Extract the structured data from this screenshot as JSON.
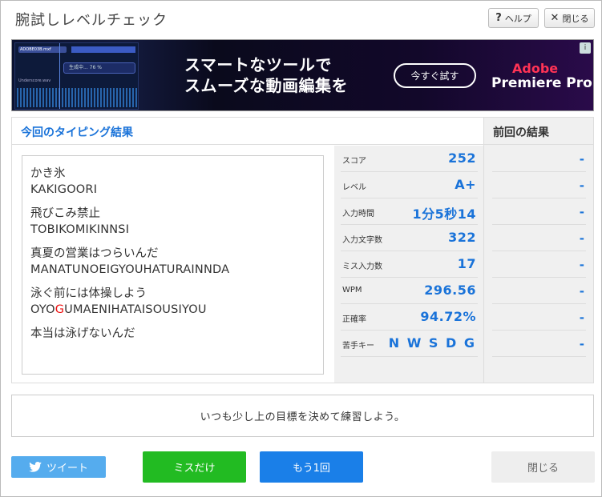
{
  "window": {
    "title": "腕試しレベルチェック",
    "help_label": "ヘルプ",
    "close_label": "閉じる"
  },
  "ad": {
    "headline_line1": "スマートなツールで",
    "headline_line2": "スムーズな動画編集を",
    "cta_label": "今すぐ試す",
    "brand_line1": "Adobe",
    "brand_line2": "Premiere Pro",
    "thumb_file": "ADOBE03B.mxf",
    "thumb_progress": "生成中...",
    "thumb_progress_pct": "76 %",
    "thumb_track": "Underscore.wav"
  },
  "result": {
    "header": "今回のタイピング結果",
    "prev_header": "前回の結果",
    "words": [
      {
        "jp": "かき氷",
        "romaji": "KAKIGOORI"
      },
      {
        "jp": "飛びこみ禁止",
        "romaji": "TOBIKOMIKINNSI"
      },
      {
        "jp": "真夏の営業はつらいんだ",
        "romaji": "MANATUNOEIGYOUHATURAINNDA"
      },
      {
        "jp": "泳ぐ前には体操しよう",
        "romaji_before": "OYO",
        "romaji_miss": "G",
        "romaji_after": "UMAENIHATAISOUSIYOU"
      },
      {
        "jp": "本当は泳げないんだ"
      }
    ],
    "stats": [
      {
        "label": "スコア",
        "value": "252",
        "prev": "-"
      },
      {
        "label": "レベル",
        "value": "A+",
        "prev": "-"
      },
      {
        "label": "入力時間",
        "value": "1分5秒14",
        "prev": "-"
      },
      {
        "label": "入力文字数",
        "value": "322",
        "prev": "-"
      },
      {
        "label": "ミス入力数",
        "value": "17",
        "prev": "-"
      },
      {
        "label": "WPM",
        "value": "296.56",
        "prev": "-"
      },
      {
        "label": "正確率",
        "value": "94.72%",
        "prev": "-"
      },
      {
        "label": "苦手キー",
        "value": "N W S D G",
        "prev": "-"
      }
    ]
  },
  "message": "いつも少し上の目標を決めて練習しよう。",
  "buttons": {
    "tweet": "ツイート",
    "miss_only": "ミスだけ",
    "retry": "もう1回",
    "close": "閉じる"
  }
}
